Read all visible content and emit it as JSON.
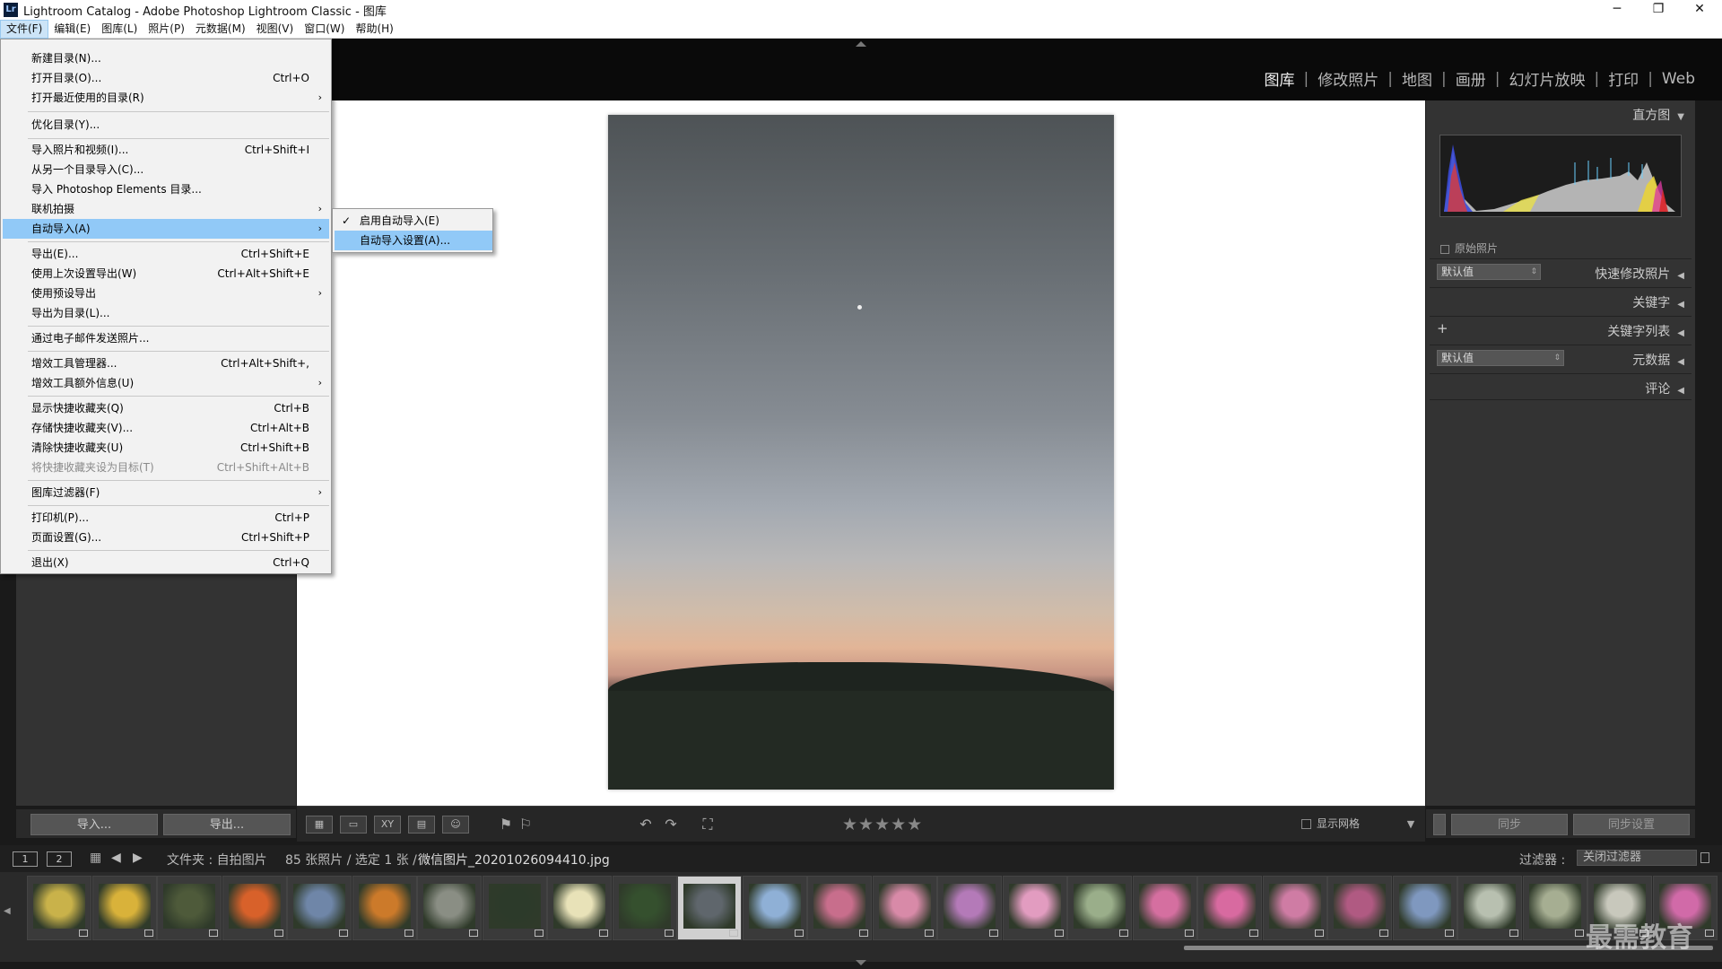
{
  "window": {
    "title": "Lightroom Catalog - Adobe Photoshop Lightroom Classic - 图库",
    "app_icon": "Lr",
    "controls": {
      "minimize": "─",
      "restore": "❐",
      "close": "✕"
    }
  },
  "menubar": [
    "文件(F)",
    "编辑(E)",
    "图库(L)",
    "照片(P)",
    "元数据(M)",
    "视图(V)",
    "窗口(W)",
    "帮助(H)"
  ],
  "modules": [
    "图库",
    "修改照片",
    "地图",
    "画册",
    "幻灯片放映",
    "打印",
    "Web"
  ],
  "file_menu": {
    "items": [
      {
        "label": "新建目录(N)...",
        "shortcut": ""
      },
      {
        "label": "打开目录(O)...",
        "shortcut": "Ctrl+O"
      },
      {
        "label": "打开最近使用的目录(R)",
        "shortcut": "",
        "sub": "›"
      },
      {
        "label": "优化目录(Y)...",
        "shortcut": ""
      },
      {
        "label": "导入照片和视频(I)...",
        "shortcut": "Ctrl+Shift+I"
      },
      {
        "label": "从另一个目录导入(C)...",
        "shortcut": ""
      },
      {
        "label": "导入 Photoshop Elements 目录...",
        "shortcut": ""
      },
      {
        "label": "联机拍摄",
        "shortcut": "",
        "sub": "›"
      },
      {
        "label": "自动导入(A)",
        "shortcut": "",
        "sub": "›"
      },
      {
        "label": "导出(E)...",
        "shortcut": "Ctrl+Shift+E"
      },
      {
        "label": "使用上次设置导出(W)",
        "shortcut": "Ctrl+Alt+Shift+E"
      },
      {
        "label": "使用预设导出",
        "shortcut": "",
        "sub": "›"
      },
      {
        "label": "导出为目录(L)...",
        "shortcut": ""
      },
      {
        "label": "通过电子邮件发送照片...",
        "shortcut": ""
      },
      {
        "label": "增效工具管理器...",
        "shortcut": "Ctrl+Alt+Shift+,"
      },
      {
        "label": "增效工具额外信息(U)",
        "shortcut": "",
        "sub": "›"
      },
      {
        "label": "显示快捷收藏夹(Q)",
        "shortcut": "Ctrl+B"
      },
      {
        "label": "存储快捷收藏夹(V)...",
        "shortcut": "Ctrl+Alt+B"
      },
      {
        "label": "清除快捷收藏夹(U)",
        "shortcut": "Ctrl+Shift+B"
      },
      {
        "label": "将快捷收藏夹设为目标(T)",
        "shortcut": "Ctrl+Shift+Alt+B"
      },
      {
        "label": "图库过滤器(F)",
        "shortcut": "",
        "sub": "›"
      },
      {
        "label": "打印机(P)...",
        "shortcut": "Ctrl+P"
      },
      {
        "label": "页面设置(G)...",
        "shortcut": "Ctrl+Shift+P"
      },
      {
        "label": "退出(X)",
        "shortcut": "Ctrl+Q"
      }
    ]
  },
  "auto_import_submenu": {
    "items": [
      {
        "label": "启用自动导入(E)",
        "checked": "✓"
      },
      {
        "label": "自动导入设置(A)..."
      }
    ]
  },
  "left_panel": {
    "import_button": "导入...",
    "export_button": "导出..."
  },
  "toolbar": {
    "stars": "★★★★★",
    "show_grid": "显示网格",
    "view_xy": "XY"
  },
  "right_panel": {
    "histogram_title": "直方图",
    "original_photo": "原始照片",
    "quick_develop": "快速修改照片",
    "quick_develop_preset": "默认值",
    "keywording": "关键字",
    "keyword_list": "关键字列表",
    "metadata": "元数据",
    "metadata_preset": "默认值",
    "comments": "评论",
    "sync_button": "同步",
    "sync_settings_button": "同步设置",
    "collapse_arrow": "◀",
    "expand_arrow": "▼",
    "plus": "+"
  },
  "info_bar": {
    "page1": "1",
    "page2": "2",
    "folder_label": "文件夹 : 自拍图片",
    "count": "85 张照片 / 选定 1 张 /",
    "filename": "微信图片_20201026094410.jpg",
    "filter_label": "过滤器 :",
    "filter_value": "关闭过滤器"
  },
  "filmstrip": {
    "thumb_colors": [
      "#c9b24a",
      "#d9b23a",
      "#4e5a3a",
      "#d8612a",
      "#6f86a8",
      "#cc7a2a",
      "#8a8e84",
      "#2c3a2a",
      "#e8e2b8",
      "#35502e",
      "#5f666c",
      "#8fb0d6",
      "#c86e8c",
      "#d88aa8",
      "#b47ab8",
      "#e29cc0",
      "#9aae8a",
      "#d56fa0",
      "#d86aa0",
      "#cf7ca4",
      "#b05a82",
      "#7f98bf",
      "#b8c0b0",
      "#a6ae92",
      "#c8c8bc",
      "#d16aa8"
    ],
    "selected_index": 10
  },
  "watermark": "最需教育"
}
